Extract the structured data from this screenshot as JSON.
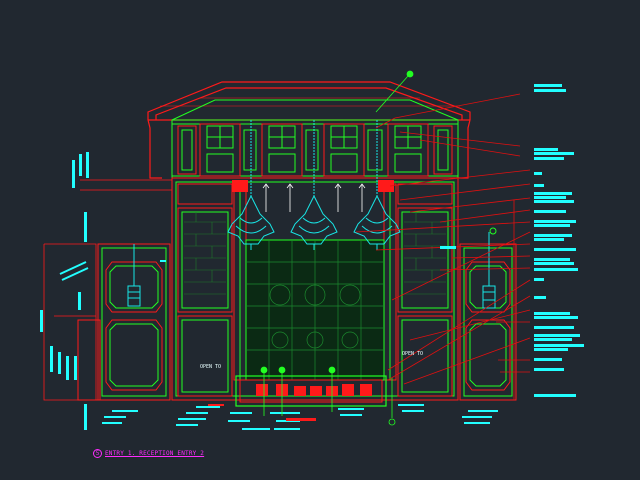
{
  "drawing": {
    "caption_number": "5",
    "caption_title": "ENTRY 1. RECEPTION ENTRY 2",
    "left_screen_label": "OPEN TO",
    "right_screen_label": "OPEN TO"
  },
  "colors": {
    "background": "#212830",
    "outline_red": "#ff1a1a",
    "outline_green": "#22ff22",
    "chandelier_cyan": "#18e6e6",
    "leader_red": "#e01010",
    "callout_cyan": "#22ffff",
    "caption_magenta": "#ff2bff"
  }
}
